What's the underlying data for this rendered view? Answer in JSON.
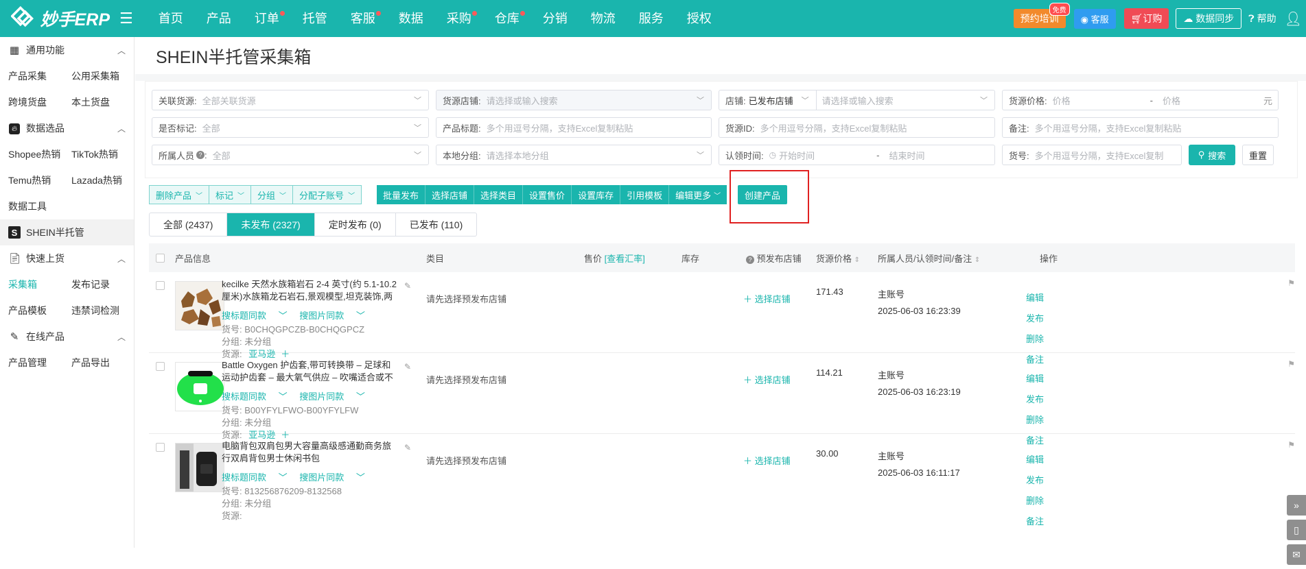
{
  "header": {
    "logo_text": "妙手ERP",
    "nav": [
      {
        "label": "首页",
        "dot": false
      },
      {
        "label": "产品",
        "dot": false
      },
      {
        "label": "订单",
        "dot": true
      },
      {
        "label": "托管",
        "dot": false
      },
      {
        "label": "客服",
        "dot": true
      },
      {
        "label": "数据",
        "dot": false
      },
      {
        "label": "采购",
        "dot": true
      },
      {
        "label": "仓库",
        "dot": true
      },
      {
        "label": "分销",
        "dot": false
      },
      {
        "label": "物流",
        "dot": false
      },
      {
        "label": "服务",
        "dot": false
      },
      {
        "label": "授权",
        "dot": false
      }
    ],
    "train_label": "预约培训",
    "free_badge": "免费",
    "service_label": "客服",
    "order_label": "订购",
    "sync_label": "数据同步",
    "help_label": "帮助"
  },
  "sidebar": {
    "sections": {
      "common": "通用功能",
      "data": "数据选品",
      "shein": "SHEIN半托管",
      "quick": "快速上货",
      "online": "在线产品"
    },
    "links": {
      "collect": "产品采集",
      "public_box": "公用采集箱",
      "cross": "跨境货盘",
      "local": "本土货盘",
      "shopee": "Shopee热销",
      "tiktok": "TikTok热销",
      "temu": "Temu热销",
      "lazada": "Lazada热销",
      "tools": "数据工具",
      "box": "采集箱",
      "records": "发布记录",
      "templates": "产品模板",
      "banned": "违禁词检测",
      "manage": "产品管理",
      "export": "产品导出"
    }
  },
  "page": {
    "title": "SHEIN半托管采集箱"
  },
  "filters": {
    "source_link": {
      "label": "关联货源:",
      "placeholder": "全部关联货源"
    },
    "source_shop": {
      "label": "货源店铺:",
      "placeholder": "请选择或输入搜索"
    },
    "shop": {
      "label": "店铺:",
      "value": "已发布店铺",
      "placeholder": "请选择或输入搜索"
    },
    "source_price": {
      "label": "货源价格:",
      "min_ph": "价格",
      "max_ph": "价格",
      "dash": "-",
      "unit": "元"
    },
    "marked": {
      "label": "是否标记:",
      "placeholder": "全部"
    },
    "product_title": {
      "label": "产品标题:",
      "placeholder": "多个用逗号分隔，支持Excel复制粘贴"
    },
    "source_id": {
      "label": "货源ID:",
      "placeholder": "多个用逗号分隔，支持Excel复制粘贴"
    },
    "note": {
      "label": "备注:",
      "placeholder": "多个用逗号分隔，支持Excel复制粘贴"
    },
    "owner": {
      "label": "所属人员",
      "placeholder": "全部"
    },
    "local_group": {
      "label": "本地分组:",
      "placeholder": "请选择本地分组"
    },
    "claim_time": {
      "label": "认领时间:",
      "start_ph": "开始时间",
      "dash": "-",
      "end_ph": "结束时间"
    },
    "sku": {
      "label": "货号:",
      "placeholder": "多个用逗号分隔，支持Excel复制"
    },
    "search_label": "搜索",
    "reset_label": "重置"
  },
  "actions": {
    "outline": [
      "删除产品",
      "标记",
      "分组",
      "分配子账号"
    ],
    "filled": [
      "批量发布",
      "选择店铺",
      "选择类目",
      "设置售价",
      "设置库存",
      "引用模板",
      "编辑更多"
    ],
    "create": "创建产品"
  },
  "tabs": [
    {
      "label": "全部 (2437)",
      "active": false
    },
    {
      "label": "未发布 (2327)",
      "active": true
    },
    {
      "label": "定时发布 (0)",
      "active": false
    },
    {
      "label": "已发布 (110)",
      "active": false
    }
  ],
  "table": {
    "headers": {
      "info": "产品信息",
      "category": "类目",
      "price": "售价",
      "rate_link": "[查看汇率]",
      "stock": "库存",
      "pre_shop": "预发布店铺",
      "source_price": "货源价格",
      "owner": "所属人员/认领时间/备注",
      "ops": "操作"
    },
    "search_title": "搜标题同款",
    "search_image": "搜图片同款",
    "sku_prefix": "货号: ",
    "group_prefix": "分组: ",
    "source_prefix": "货源: ",
    "rows": [
      {
        "title": "kecilke 天然水族箱岩石 2-4 英寸(约 5.1-10.2 厘米)水族箱龙石岩石,景观模型,坦克装饰,两栖动物围栏-龙石-...",
        "sku": "B0CHQGPCZB-B0CHQGPCZ",
        "group": "未分组",
        "source": "亚马逊",
        "category": "请先选择预发布店铺",
        "pick_shop": "选择店铺",
        "price": "171.43",
        "owner": "主账号",
        "time": "2025-06-03 16:23:39",
        "ops": [
          "编辑",
          "发布",
          "删除",
          "备注"
        ]
      },
      {
        "title": "Battle Oxygen 护齿套,带可转换带 – 足球和运动护齿套 – 最大氧气供应 – 吹嘴适合或不带牙套 – 冲击护罩覆...",
        "sku": "B00YFYLFWO-B00YFYLFW",
        "group": "未分组",
        "source": "亚马逊",
        "category": "请先选择预发布店铺",
        "pick_shop": "选择店铺",
        "price": "114.21",
        "owner": "主账号",
        "time": "2025-06-03 16:23:19",
        "ops": [
          "编辑",
          "发布",
          "删除",
          "备注"
        ]
      },
      {
        "title": "电脑背包双肩包男大容量高级感通勤商务旅行双肩背包男士休闲书包",
        "sku": "813256876209-8132568",
        "group": "未分组",
        "source": "",
        "category": "请先选择预发布店铺",
        "pick_shop": "选择店铺",
        "price": "30.00",
        "owner": "主账号",
        "time": "2025-06-03 16:11:17",
        "ops": [
          "编辑",
          "发布",
          "删除",
          "备注"
        ]
      }
    ]
  },
  "colors": {
    "brand": "#1ab5ad",
    "highlight": "#e02020"
  }
}
